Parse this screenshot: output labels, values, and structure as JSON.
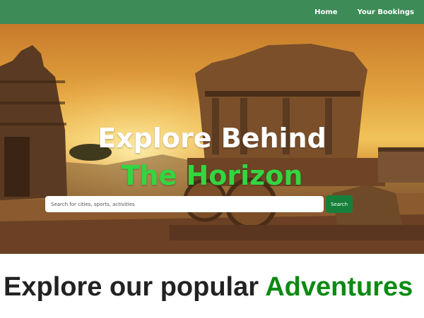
{
  "nav": {
    "items": [
      {
        "label": "Home"
      },
      {
        "label": "Your Bookings"
      }
    ]
  },
  "hero": {
    "title_line1": "Explore Behind",
    "title_line2": "The Horizon",
    "search": {
      "placeholder": "Search for cities, sports, activities",
      "value": "",
      "button_label": "Search"
    }
  },
  "section": {
    "heading_prefix": "Explore our popular",
    "heading_accent": "Adventures"
  },
  "colors": {
    "nav_bg": "#3d8b57",
    "accent_green": "#33d640",
    "button_green": "#16803b",
    "heading_accent": "#0d8a14"
  }
}
